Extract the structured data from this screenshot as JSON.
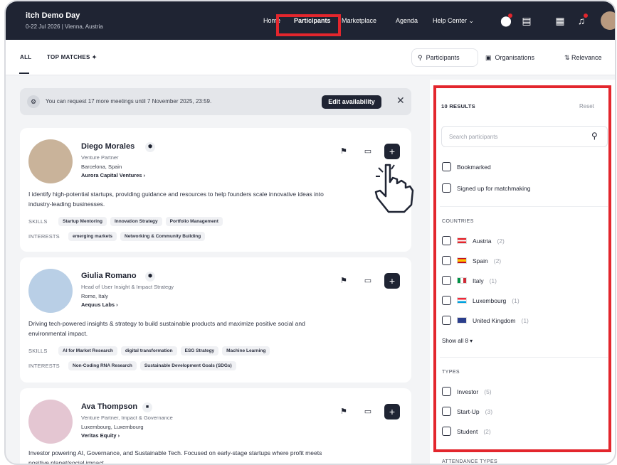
{
  "event": {
    "title": "itch Demo Day",
    "subtitle": "0-22 Jul 2026 | Vienna, Austria"
  },
  "nav": {
    "home": "Home",
    "participants": "Participants",
    "marketplace": "Marketplace",
    "agenda": "Agenda",
    "help": "Help Center ⌄"
  },
  "tabs": {
    "all": "ALL",
    "top_matches": "TOP MATCHES ✦"
  },
  "segment": {
    "participants": "Participants",
    "organisations": "Organisations"
  },
  "sort": {
    "label": "⇅ Relevance"
  },
  "notice": {
    "text": "You can request 17 more meetings until 7 November 2025, 23:59.",
    "button": "Edit availability",
    "close": "✕"
  },
  "labels": {
    "skills": "SKILLS",
    "interests": "INTERESTS"
  },
  "participants": [
    {
      "name": "Diego Morales",
      "badge": "⬢",
      "role": "Venture Partner",
      "location": "Barcelona, Spain",
      "company": "Aurora Capital Ventures ›",
      "bio": "I identify high-potential startups, providing guidance and resources to help founders scale innovative ideas into industry-leading businesses.",
      "skills": [
        "Startup Mentoring",
        "Innovation Strategy",
        "Portfolio Management"
      ],
      "interests": [
        "emerging markets",
        "Networking & Community Building"
      ],
      "photo_color": "#c9b39a"
    },
    {
      "name": "Giulia Romano",
      "badge": "⬢",
      "role": "Head of User Insight & Impact Strategy",
      "location": "Rome, Italy",
      "company": "Aequus Labs ›",
      "bio": "Driving tech-powered insights & strategy to build sustainable products and maximize positive social and environmental impact.",
      "skills": [
        "AI for Market Research",
        "digital transformation",
        "ESG Strategy",
        "Machine Learning"
      ],
      "interests": [
        "Non-Coding RNA Research",
        "Sustainable Development Goals (SDGs)"
      ],
      "photo_color": "#b9cfe6"
    },
    {
      "name": "Ava Thompson",
      "badge": "■",
      "role": "Venture Partner, Impact & Governance",
      "location": "Luxembourg, Luxembourg",
      "company": "Veritas Equity ›",
      "bio": "Investor powering AI, Governance, and Sustainable Tech. Focused on early-stage startups where profit meets positive planet/social impact.",
      "photo_color": "#e4c6d2"
    }
  ],
  "filters": {
    "results": "10 RESULTS",
    "reset": "Reset",
    "search_placeholder": "Search participants",
    "bookmarked": "Bookmarked",
    "signed_up": "Signed up for matchmaking",
    "countries_label": "COUNTRIES",
    "countries": [
      {
        "name": "Austria",
        "count": "(2)"
      },
      {
        "name": "Spain",
        "count": "(2)"
      },
      {
        "name": "Italy",
        "count": "(1)"
      },
      {
        "name": "Luxembourg",
        "count": "(1)"
      },
      {
        "name": "United Kingdom",
        "count": "(1)"
      }
    ],
    "show_all": "Show all 8 ▾",
    "types_label": "TYPES",
    "types": [
      {
        "name": "Investor",
        "count": "(5)"
      },
      {
        "name": "Start-Up",
        "count": "(3)"
      },
      {
        "name": "Student",
        "count": "(2)"
      }
    ],
    "attendance_label": "ATTENDANCE TYPES"
  },
  "colors": {
    "topbar": "#1f2433",
    "highlight": "#e3262d"
  }
}
